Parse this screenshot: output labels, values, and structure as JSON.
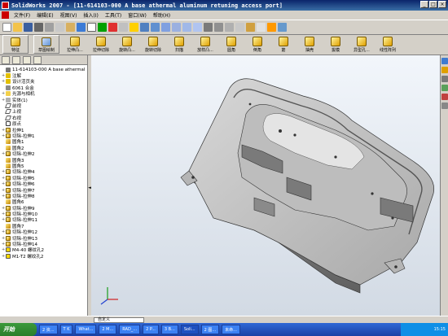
{
  "window": {
    "title": "SolidWorks 2007 - [11-614103-000 A base athermal aluminum retuning access port]"
  },
  "menu": [
    "文件(F)",
    "编辑(E)",
    "视图(V)",
    "插入(I)",
    "工具(T)",
    "窗口(W)",
    "帮助(H)"
  ],
  "features_toolbar": [
    {
      "label": "特征",
      "icon": "features-icon"
    },
    {
      "label": "草图绘制",
      "icon": "sketch-icon"
    },
    {
      "label": "拉伸凸...",
      "icon": "extrude-boss-icon"
    },
    {
      "label": "拉伸切除",
      "icon": "extrude-cut-icon"
    },
    {
      "label": "旋转凸...",
      "icon": "revolve-boss-icon"
    },
    {
      "label": "旋转切除",
      "icon": "revolve-cut-icon"
    },
    {
      "label": "扫描",
      "icon": "sweep-icon"
    },
    {
      "label": "放样凸...",
      "icon": "loft-icon"
    },
    {
      "label": "圆角",
      "icon": "fillet-icon"
    },
    {
      "label": "倒角",
      "icon": "chamfer-icon"
    },
    {
      "label": "筋",
      "icon": "rib-icon"
    },
    {
      "label": "抽壳",
      "icon": "shell-icon"
    },
    {
      "label": "拔模",
      "icon": "draft-icon"
    },
    {
      "label": "异型孔...",
      "icon": "hole-wizard-icon"
    },
    {
      "label": "线性阵列",
      "icon": "linear-pattern-icon"
    }
  ],
  "tree": [
    {
      "label": "11-614103-000 A base athermal",
      "icon": "part",
      "exp": ""
    },
    {
      "label": "注解",
      "icon": "note",
      "exp": "+"
    },
    {
      "label": "设计活页夹",
      "icon": "note",
      "exp": "+"
    },
    {
      "label": "6061 合金",
      "icon": "mat",
      "exp": ""
    },
    {
      "label": "光源与相机",
      "icon": "light",
      "exp": "+"
    },
    {
      "label": "实体(1)",
      "icon": "solid",
      "exp": "+"
    },
    {
      "label": "前视",
      "icon": "plane",
      "exp": ""
    },
    {
      "label": "上视",
      "icon": "plane",
      "exp": ""
    },
    {
      "label": "右视",
      "icon": "plane",
      "exp": ""
    },
    {
      "label": "原点",
      "icon": "origin",
      "exp": ""
    },
    {
      "label": "拉伸1",
      "icon": "feat",
      "exp": "+"
    },
    {
      "label": "切除-拉伸1",
      "icon": "feat",
      "exp": "+"
    },
    {
      "label": "圆角1",
      "icon": "fillet",
      "exp": ""
    },
    {
      "label": "圆角2",
      "icon": "fillet",
      "exp": ""
    },
    {
      "label": "切除-拉伸2",
      "icon": "feat",
      "exp": "+"
    },
    {
      "label": "圆角3",
      "icon": "fillet",
      "exp": ""
    },
    {
      "label": "圆角5",
      "icon": "fillet",
      "exp": ""
    },
    {
      "label": "切除-拉伸4",
      "icon": "feat",
      "exp": "+"
    },
    {
      "label": "切除-拉伸5",
      "icon": "feat",
      "exp": "+"
    },
    {
      "label": "切除-拉伸6",
      "icon": "feat",
      "exp": "+"
    },
    {
      "label": "切除-拉伸7",
      "icon": "feat",
      "exp": "+"
    },
    {
      "label": "切除-拉伸8",
      "icon": "feat",
      "exp": "+"
    },
    {
      "label": "圆角6",
      "icon": "fillet",
      "exp": ""
    },
    {
      "label": "切除-拉伸9",
      "icon": "feat",
      "exp": "+"
    },
    {
      "label": "切除-拉伸10",
      "icon": "feat",
      "exp": "+"
    },
    {
      "label": "切除-拉伸11",
      "icon": "feat",
      "exp": "+"
    },
    {
      "label": "圆角7",
      "icon": "fillet",
      "exp": ""
    },
    {
      "label": "切除-拉伸12",
      "icon": "feat",
      "exp": "+"
    },
    {
      "label": "切除-拉伸13",
      "icon": "feat",
      "exp": "+"
    },
    {
      "label": "切除-拉伸14",
      "icon": "feat",
      "exp": "+"
    },
    {
      "label": "M4-40 螺纹孔2",
      "icon": "hole",
      "exp": "+"
    },
    {
      "label": "M1-T2 螺纹孔2",
      "icon": "hole",
      "exp": "+"
    }
  ],
  "statusbar": {
    "view": "自定义"
  },
  "taskbar": {
    "start": "开始",
    "tasks": [
      "2 资...",
      "T K",
      "What...",
      "2 M...",
      "RAD_...",
      "2 P...",
      "3 B...",
      "Soli...",
      "2 图...",
      "未命..."
    ],
    "clock": "15:15"
  }
}
